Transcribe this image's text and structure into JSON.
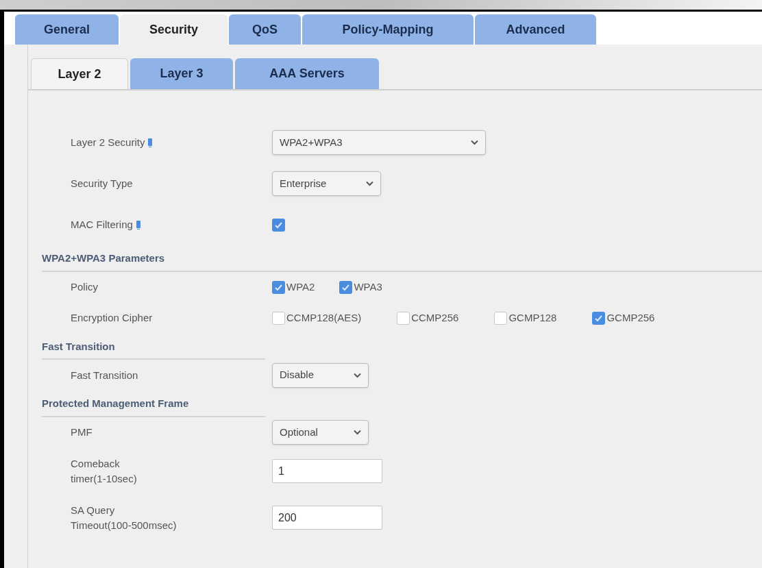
{
  "tabs": [
    {
      "label": "General",
      "selected": false
    },
    {
      "label": "Security",
      "selected": true
    },
    {
      "label": "QoS",
      "selected": false
    },
    {
      "label": "Policy-Mapping",
      "selected": false
    },
    {
      "label": "Advanced",
      "selected": false
    }
  ],
  "subtabs": [
    {
      "label": "Layer 2",
      "selected": true
    },
    {
      "label": "Layer 3",
      "selected": false
    },
    {
      "label": "AAA Servers",
      "selected": false
    }
  ],
  "rows": [
    {
      "label": "Layer 2 Security",
      "help": true,
      "control": {
        "kind": "select",
        "value": "WPA2+WPA3"
      }
    },
    {
      "label": "Security Type",
      "help": false,
      "control": {
        "kind": "select",
        "value": "Enterprise"
      }
    },
    {
      "label": "MAC Filtering",
      "help": true,
      "control": {
        "kind": "checkbox",
        "checked": true
      }
    }
  ],
  "sections": [
    {
      "title": "WPA2+WPA3 Parameters",
      "rows": [
        {
          "label": "Policy",
          "help": false,
          "control": {
            "kind": "options",
            "options": [
              {
                "label": "WPA2",
                "checked": true
              },
              {
                "label": "WPA3",
                "checked": true
              }
            ]
          }
        },
        {
          "label": "Encryption Cipher",
          "help": false,
          "control": {
            "kind": "options",
            "options": [
              {
                "label": "CCMP128(AES)",
                "checked": false
              },
              {
                "label": "CCMP256",
                "checked": false
              },
              {
                "label": "GCMP128",
                "checked": false
              },
              {
                "label": "GCMP256",
                "checked": true
              }
            ]
          }
        }
      ]
    },
    {
      "title": "Fast Transition",
      "rows": [
        {
          "label": "Fast Transition",
          "help": false,
          "control": {
            "kind": "select",
            "value": "Disable"
          }
        }
      ]
    },
    {
      "title": "Protected Management Frame",
      "rows": [
        {
          "label": "PMF",
          "help": false,
          "control": {
            "kind": "select",
            "value": "Optional"
          }
        },
        {
          "label": "Comeback\ntimer(1-10sec)",
          "help": false,
          "control": {
            "kind": "text",
            "value": "1"
          }
        },
        {
          "label": "SA Query\nTimeout(100-500msec)",
          "help": false,
          "control": {
            "kind": "text",
            "value": "200"
          }
        }
      ]
    }
  ]
}
